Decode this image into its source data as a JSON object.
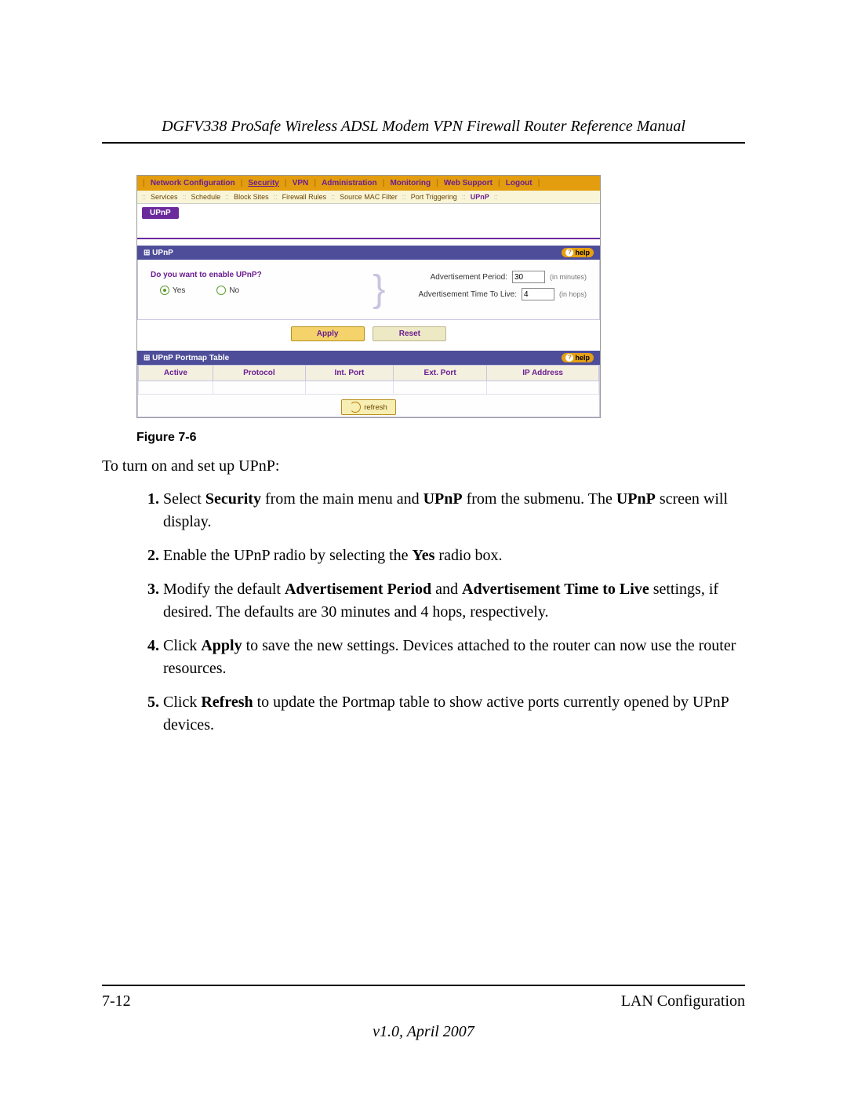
{
  "doc": {
    "title": "DGFV338 ProSafe Wireless ADSL Modem VPN Firewall Router Reference Manual",
    "figure_caption": "Figure 7-6",
    "lead": "To turn on and set up UPnP:",
    "page_num": "7-12",
    "section": "LAN Configuration",
    "version": "v1.0, April 2007"
  },
  "steps": {
    "s1a": "Select ",
    "s1b": "Security",
    "s1c": " from the main menu and ",
    "s1d": "UPnP",
    "s1e": " from the submenu. The ",
    "s1f": "UPnP",
    "s1g": " screen will display.",
    "s2a": "Enable the UPnP radio by selecting the ",
    "s2b": "Yes",
    "s2c": " radio box.",
    "s3a": "Modify the default ",
    "s3b": "Advertisement Period",
    "s3c": " and ",
    "s3d": "Advertisement Time to Live",
    "s3e": " settings, if desired. The defaults are 30 minutes and 4 hops, respectively.",
    "s4a": "Click ",
    "s4b": "Apply",
    "s4c": " to save the new settings. Devices attached to the router can now use the router resources.",
    "s5a": "Click ",
    "s5b": "Refresh",
    "s5c": " to update the Portmap table to show active ports currently opened by UPnP devices."
  },
  "ui": {
    "mainmenu": {
      "items": [
        "Network Configuration",
        "Security",
        "VPN",
        "Administration",
        "Monitoring",
        "Web Support",
        "Logout"
      ],
      "selected": "Security"
    },
    "submenu": {
      "items": [
        "Services",
        "Schedule",
        "Block Sites",
        "Firewall Rules",
        "Source MAC Filter",
        "Port Triggering",
        "UPnP"
      ],
      "selected": "UPnP"
    },
    "tab": "UPnP",
    "section1": {
      "title": "UPnP",
      "help": "help",
      "question": "Do you want to enable UPnP?",
      "yes": "Yes",
      "no": "No",
      "adv_period_label": "Advertisement Period:",
      "adv_period_value": "30",
      "adv_period_unit": "(in minutes)",
      "adv_ttl_label": "Advertisement Time To Live:",
      "adv_ttl_value": "4",
      "adv_ttl_unit": "(in hops)"
    },
    "buttons": {
      "apply": "Apply",
      "reset": "Reset",
      "refresh": "refresh"
    },
    "section2": {
      "title": "UPnP Portmap Table",
      "help": "help",
      "cols": [
        "Active",
        "Protocol",
        "Int. Port",
        "Ext. Port",
        "IP Address"
      ]
    }
  }
}
